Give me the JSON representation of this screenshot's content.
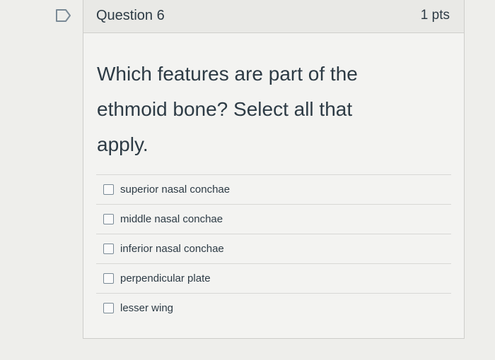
{
  "question": {
    "title": "Question 6",
    "points": "1 pts",
    "prompt_line1": "Which features are part of the",
    "prompt_line2": "ethmoid bone? Select all that",
    "prompt_line3": "apply."
  },
  "flag": {
    "icon": "flag-question-icon"
  },
  "answers": [
    {
      "label": "superior nasal conchae",
      "checked": false
    },
    {
      "label": "middle nasal conchae",
      "checked": false
    },
    {
      "label": "inferior nasal conchae",
      "checked": false
    },
    {
      "label": "perpendicular plate",
      "checked": false
    },
    {
      "label": "lesser wing",
      "checked": false
    }
  ]
}
